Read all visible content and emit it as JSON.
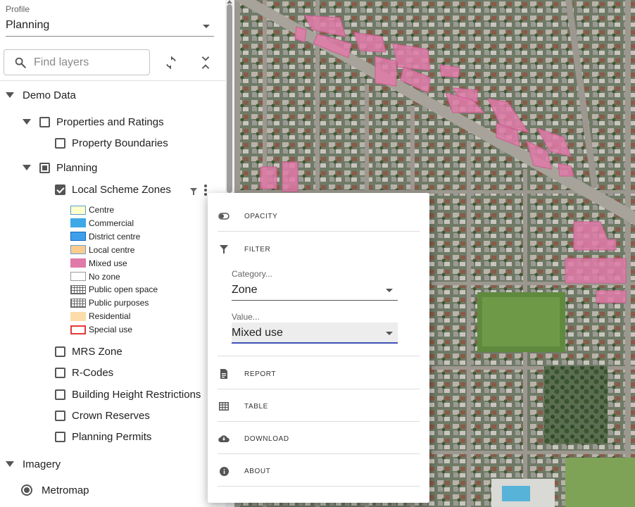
{
  "profile": {
    "label": "Profile",
    "value": "Planning"
  },
  "search": {
    "placeholder": "Find layers"
  },
  "tree": {
    "demo_data": "Demo Data",
    "properties_and_ratings": "Properties and Ratings",
    "property_boundaries": "Property Boundaries",
    "planning": "Planning",
    "local_scheme_zones": "Local Scheme Zones",
    "mrs_zone": "MRS Zone",
    "r_codes": "R-Codes",
    "building_height": "Building Height Restrictions",
    "crown_reserves": "Crown Reserves",
    "planning_permits": "Planning Permits",
    "imagery": "Imagery",
    "metromap": "Metromap"
  },
  "legend": [
    {
      "label": "Centre",
      "color": "#ffffcc",
      "border": "#55a0d0",
      "pattern": "none"
    },
    {
      "label": "Commercial",
      "color": "#3fa9e8",
      "border": "#3fa9e8",
      "pattern": "none"
    },
    {
      "label": "District centre",
      "color": "#3fa0ea",
      "border": "#1565c0",
      "pattern": "none"
    },
    {
      "label": "Local centre",
      "color": "#fccb8e",
      "border": "#6aa0d0",
      "pattern": "none"
    },
    {
      "label": "Mixed use",
      "color": "#e07aa8",
      "border": "#e07aa8",
      "pattern": "none"
    },
    {
      "label": "No zone",
      "color": "#ffffff",
      "border": "#999999",
      "pattern": "none"
    },
    {
      "label": "Public open space",
      "color": "#ffffff",
      "border": "#666666",
      "pattern": "hatch"
    },
    {
      "label": "Public purposes",
      "color": "#ffffff",
      "border": "#666666",
      "pattern": "hatch"
    },
    {
      "label": "Residential",
      "color": "#fcdcaa",
      "border": "#fcdcaa",
      "pattern": "none"
    },
    {
      "label": "Special use",
      "color": "#ffffff",
      "border": "#e53935",
      "pattern": "none"
    }
  ],
  "menu": {
    "opacity": "OPACITY",
    "filter": "FILTER",
    "category_label": "Category...",
    "category_value": "Zone",
    "value_label": "Value...",
    "value_value": "Mixed use",
    "report": "REPORT",
    "table": "TABLE",
    "download": "DOWNLOAD",
    "about": "ABOUT"
  },
  "colors": {
    "mixed_use_fill": "#e07aa8",
    "focus_underline": "#3f51b5"
  },
  "icons": [
    "search-icon",
    "refresh-icon",
    "collapse-all-icon",
    "filter-icon",
    "more-vert-icon",
    "opacity-icon",
    "report-icon",
    "table-icon",
    "download-icon",
    "about-icon"
  ]
}
